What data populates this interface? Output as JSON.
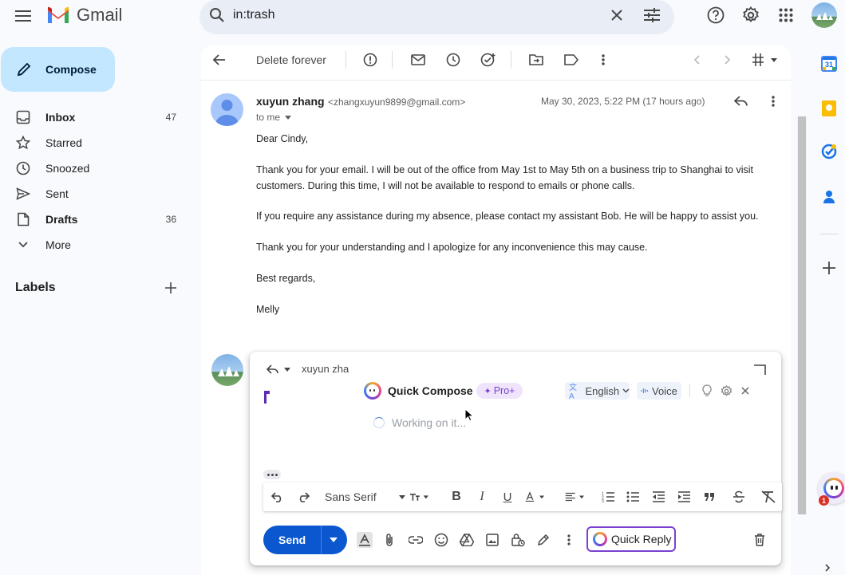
{
  "header": {
    "app_name": "Gmail",
    "search_value": "in:trash"
  },
  "sidebar": {
    "compose_label": "Compose",
    "items": [
      {
        "label": "Inbox",
        "count": "47",
        "bold": true
      },
      {
        "label": "Starred",
        "count": ""
      },
      {
        "label": "Snoozed",
        "count": ""
      },
      {
        "label": "Sent",
        "count": ""
      },
      {
        "label": "Drafts",
        "count": "36",
        "bold": true
      },
      {
        "label": "More",
        "count": ""
      }
    ],
    "labels_heading": "Labels"
  },
  "toolbar": {
    "delete_forever": "Delete forever"
  },
  "email": {
    "sender_name": "xuyun zhang",
    "sender_email": "<zhangxuyun9899@gmail.com>",
    "date": "May 30, 2023, 5:22 PM (17 hours ago)",
    "to": "to me",
    "greeting": "Dear Cindy,",
    "para1": "Thank you for your email. I will be out of the office from May 1st to May 5th on a business trip to Shanghai to visit customers. During this time, I will not be available to respond to emails or phone calls.",
    "para2": "If you require any assistance during my absence, please contact my assistant Bob. He will be happy to assist you.",
    "para3": "Thank you for your understanding and I apologize for any inconvenience this may cause.",
    "closing": "Best regards,",
    "signature": "Melly"
  },
  "reply": {
    "recipient": "xuyun zha",
    "quick_compose": {
      "title": "Quick Compose",
      "pro_badge": "Pro+",
      "language": "English",
      "voice": "Voice",
      "status": "Working on it..."
    },
    "format": {
      "font": "Sans Serif"
    },
    "send_label": "Send",
    "quick_reply_label": "Quick Reply"
  },
  "colors": {
    "compose_bg": "#c2e7ff",
    "send_bg": "#0b57d0",
    "search_bg": "#e9eef6",
    "accent_purple": "#7b40d1"
  },
  "widget": {
    "badge_count": "1"
  }
}
